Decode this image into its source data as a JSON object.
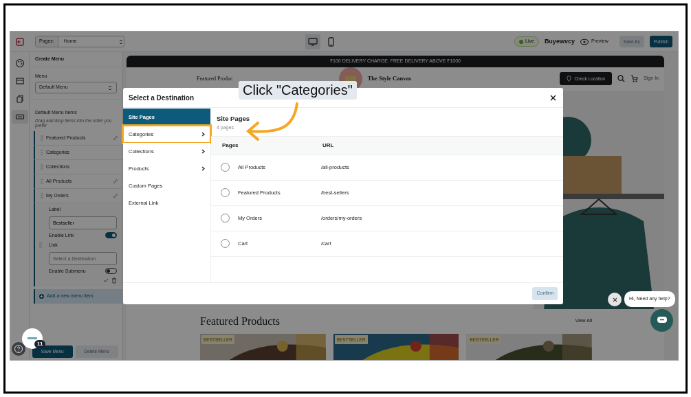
{
  "toolbar": {
    "pages_label": "Pages:",
    "page_value": "Home",
    "devices": [
      {
        "kind": "desktop",
        "selected": true
      },
      {
        "kind": "mobile",
        "selected": false
      }
    ],
    "live": "Live",
    "store_name": "Buyewvcy",
    "preview": "Preview",
    "save_as": {
      "label": "Save As",
      "disabled": true
    },
    "publish": "Publish"
  },
  "rail": [
    {
      "kind": "palette",
      "selected": false
    },
    {
      "kind": "layout",
      "selected": false
    },
    {
      "kind": "pages",
      "selected": false
    },
    {
      "kind": "menu",
      "selected": true
    }
  ],
  "menu_panel": {
    "title": "Create Menu",
    "menu_label": "Menu",
    "menu_value": "Default Menu",
    "items_title": "Default Menu Items",
    "items_hint": "Drag and drop items into the order you prefer",
    "items": [
      {
        "label": "Featured Products",
        "linked": true,
        "expanded": false
      },
      {
        "label": "Categories",
        "linked": false,
        "expanded": false
      },
      {
        "label": "Collections",
        "linked": false,
        "expanded": false
      },
      {
        "label": "All Products",
        "linked": true,
        "expanded": false
      },
      {
        "label": "My Orders",
        "linked": true,
        "expanded": true
      }
    ],
    "editor": {
      "label_title": "Label",
      "label_value": "Bestseller",
      "enable_link": "Enable Link",
      "enable_link_on": true,
      "link_title": "Link",
      "link_placeholder": "Select a Destination",
      "enable_submenu": "Enable Submenu",
      "enable_submenu_on": false
    },
    "add_item": "Add a new menu item",
    "save": "Save Menu",
    "delete": {
      "label": "Delete Menu",
      "disabled": true
    }
  },
  "help_badge": "11",
  "preview": {
    "banner": "₹100 DELIVERY CHARGE. FREE DELIVERY ABOVE ₹1000",
    "nav_link": "Featured Produc",
    "store_title": "The Style Canvas",
    "check_location": "Check Location",
    "sign_in": "Sign In",
    "section_title": "Featured Products",
    "view_all": "View All",
    "products": [
      {
        "badge": "BESTSELLER",
        "kind": "picture"
      },
      {
        "badge": "BESTSELLER",
        "kind": "picture"
      },
      {
        "badge": "BESTSELLER",
        "kind": "picture"
      }
    ]
  },
  "modal": {
    "title": "Select a Destination",
    "nav": [
      {
        "label": "Site Pages",
        "selected": true,
        "submenu": false,
        "highlighted": false
      },
      {
        "label": "Categories",
        "selected": false,
        "submenu": true,
        "highlighted": true
      },
      {
        "label": "Collections",
        "selected": false,
        "submenu": true,
        "highlighted": false
      },
      {
        "label": "Products",
        "selected": false,
        "submenu": true,
        "highlighted": false
      },
      {
        "label": "Custom Pages",
        "selected": false,
        "submenu": false,
        "highlighted": false
      },
      {
        "label": "External Link",
        "selected": false,
        "submenu": false,
        "highlighted": false
      }
    ],
    "section_title": "Site Pages",
    "count": "4 pages",
    "columns": [
      "Pages",
      "URL"
    ],
    "rows": [
      {
        "page": "All Products",
        "url": "/all-products",
        "selected": false
      },
      {
        "page": "Featured Products",
        "url": "/best-sellers",
        "selected": false
      },
      {
        "page": "My Orders",
        "url": "/orders/my-orders",
        "selected": false
      },
      {
        "page": "Cart",
        "url": "/cart",
        "selected": false
      }
    ],
    "confirm": {
      "label": "Confirm",
      "disabled": true
    }
  },
  "chat": {
    "message": "Hi, Need any help?"
  },
  "annotation": {
    "callout": "Click \"Categories\""
  }
}
